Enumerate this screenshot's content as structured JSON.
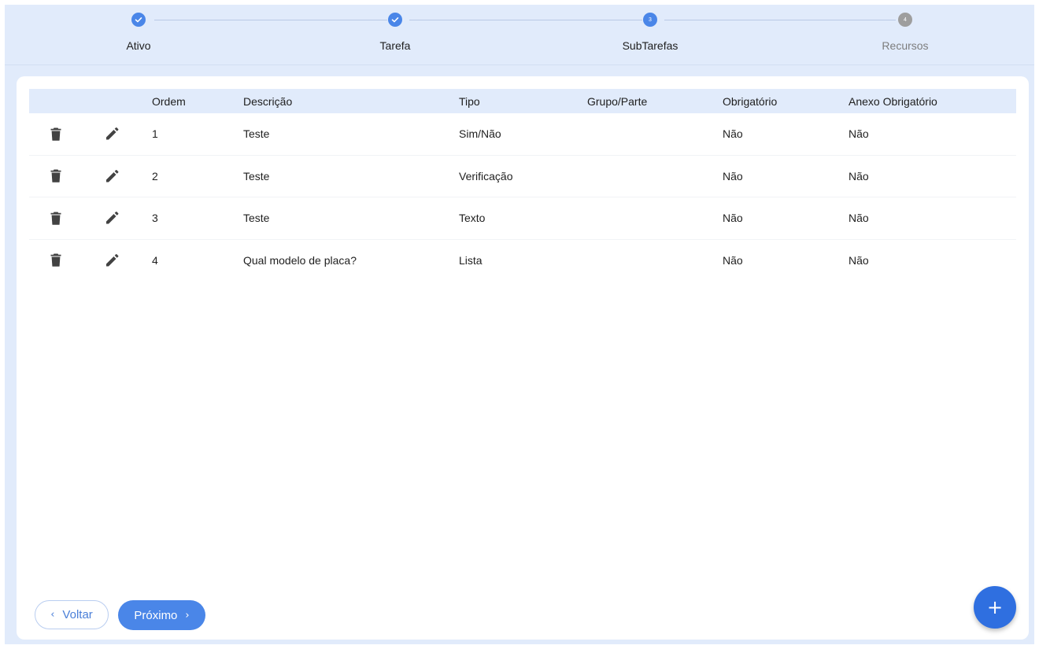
{
  "stepper": {
    "steps": [
      {
        "label": "Ativo",
        "state": "done",
        "marker": "check-icon"
      },
      {
        "label": "Tarefa",
        "state": "done",
        "marker": "check-icon"
      },
      {
        "label": "SubTarefas",
        "state": "active",
        "number": "3"
      },
      {
        "label": "Recursos",
        "state": "pending",
        "number": "4"
      }
    ]
  },
  "table": {
    "columns": [
      "",
      "",
      "Ordem",
      "Descrição",
      "Tipo",
      "Grupo/Parte",
      "Obrigatório",
      "Anexo Obrigatório"
    ],
    "rows": [
      {
        "ordem": "1",
        "descricao": "Teste",
        "tipo": "Sim/Não",
        "grupo": "",
        "obrigatorio": "Não",
        "anexo": "Não"
      },
      {
        "ordem": "2",
        "descricao": "Teste",
        "tipo": "Verificação",
        "grupo": "",
        "obrigatorio": "Não",
        "anexo": "Não"
      },
      {
        "ordem": "3",
        "descricao": "Teste",
        "tipo": "Texto",
        "grupo": "",
        "obrigatorio": "Não",
        "anexo": "Não"
      },
      {
        "ordem": "4",
        "descricao": "Qual modelo de placa?",
        "tipo": "Lista",
        "grupo": "",
        "obrigatorio": "Não",
        "anexo": "Não"
      }
    ],
    "row_icons": [
      "trash-icon",
      "pencil-icon"
    ]
  },
  "actions": {
    "back_label": "Voltar",
    "next_label": "Próximo",
    "add_label": "+"
  },
  "colors": {
    "background": "#e1ebfb",
    "accent": "#4a86e8",
    "fab": "#2f6fe0",
    "pending": "#9e9e9e"
  }
}
